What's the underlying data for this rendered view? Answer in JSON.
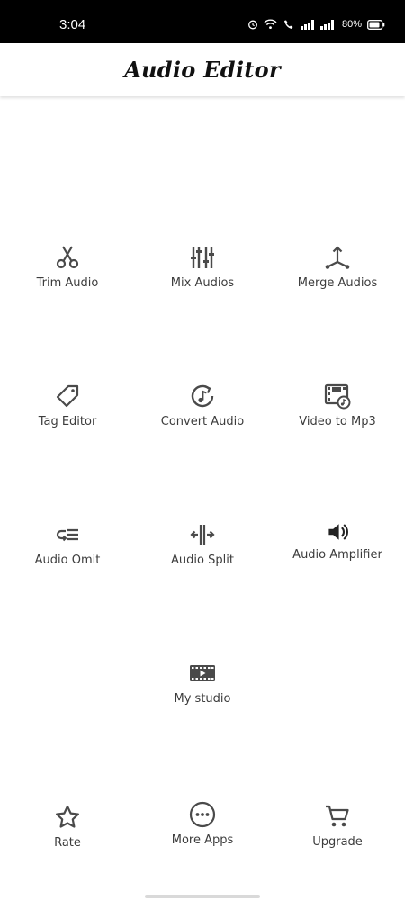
{
  "status_bar": {
    "time": "3:04",
    "battery": "80%"
  },
  "header": {
    "title": "Audio Editor"
  },
  "tools": {
    "trim": "Trim Audio",
    "mix": "Mix Audios",
    "merge": "Merge Audios",
    "tag": "Tag Editor",
    "convert": "Convert Audio",
    "video": "Video to Mp3",
    "omit": "Audio Omit",
    "split": "Audio Split",
    "amplifier": "Audio Amplifier",
    "studio": "My studio"
  },
  "bottom": {
    "rate": "Rate",
    "more": "More Apps",
    "upgrade": "Upgrade"
  },
  "icons": [
    "scissors-icon",
    "equalizer-icon",
    "merge-icon",
    "tag-icon",
    "convert-icon",
    "video-music-icon",
    "omit-icon",
    "split-icon",
    "speaker-icon",
    "film-icon",
    "star-icon",
    "more-icon",
    "cart-icon"
  ],
  "colors": {
    "icon": "#4a4a4a",
    "text": "#3c3c3c",
    "status_bar": "#000000"
  }
}
